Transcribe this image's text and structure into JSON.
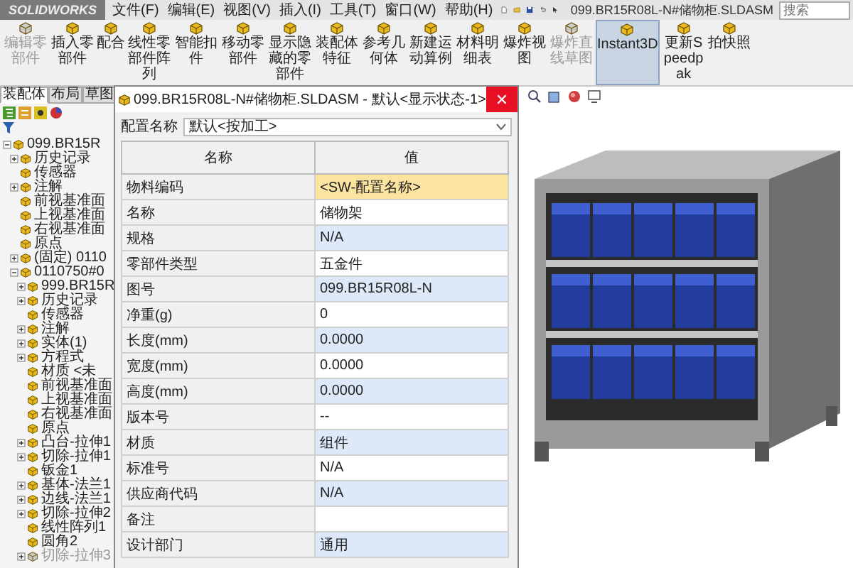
{
  "app": {
    "logo": "SOLIDWORKS",
    "menus": [
      "文件(F)",
      "编辑(E)",
      "视图(V)",
      "插入(I)",
      "工具(T)",
      "窗口(W)",
      "帮助(H)"
    ],
    "document_title": "099.BR15R08L-N#储物柜.SLDASM",
    "search": {
      "placeholder": "搜索"
    }
  },
  "ribbon": [
    {
      "label": "编辑零部件",
      "disabled": true,
      "selected": false
    },
    {
      "label": "插入零部件",
      "disabled": false,
      "selected": false
    },
    {
      "label": "配合",
      "disabled": false,
      "selected": false
    },
    {
      "label": "线性零部件阵列",
      "disabled": false,
      "selected": false
    },
    {
      "label": "智能扣件",
      "disabled": false,
      "selected": false
    },
    {
      "label": "移动零部件",
      "disabled": false,
      "selected": false
    },
    {
      "label": "显示隐藏的零部件",
      "disabled": false,
      "selected": false
    },
    {
      "label": "装配体特征",
      "disabled": false,
      "selected": false
    },
    {
      "label": "参考几何体",
      "disabled": false,
      "selected": false
    },
    {
      "label": "新建运动算例",
      "disabled": false,
      "selected": false
    },
    {
      "label": "材料明细表",
      "disabled": false,
      "selected": false
    },
    {
      "label": "爆炸视图",
      "disabled": false,
      "selected": false
    },
    {
      "label": "爆炸直线草图",
      "disabled": true,
      "selected": false
    },
    {
      "label": "Instant3D",
      "disabled": false,
      "selected": true
    },
    {
      "label": "更新Speedpak",
      "disabled": false,
      "selected": false
    },
    {
      "label": "拍快照",
      "disabled": false,
      "selected": false
    }
  ],
  "panel_tabs": [
    {
      "label": "装配体",
      "selected": true
    },
    {
      "label": "布局",
      "selected": false
    },
    {
      "label": "草图",
      "selected": false
    }
  ],
  "tree": [
    {
      "label": "099.BR15R",
      "expanded": true,
      "suppressed": false,
      "children": [
        {
          "label": "历史记录",
          "expanded": false,
          "suppressed": false
        },
        {
          "label": "传感器",
          "suppressed": false
        },
        {
          "label": "注解",
          "expanded": false,
          "suppressed": false
        },
        {
          "label": "前视基准面",
          "suppressed": false
        },
        {
          "label": "上视基准面",
          "suppressed": false
        },
        {
          "label": "右视基准面",
          "suppressed": false
        },
        {
          "label": "原点",
          "suppressed": false
        },
        {
          "label": "(固定) 0110",
          "expanded": false,
          "suppressed": false
        },
        {
          "label": "0110750#0",
          "expanded": true,
          "suppressed": false,
          "children": [
            {
              "label": "999.BR15R",
              "expanded": false,
              "suppressed": false
            },
            {
              "label": "历史记录",
              "expanded": false,
              "suppressed": false
            },
            {
              "label": "传感器",
              "suppressed": false
            },
            {
              "label": "注解",
              "expanded": false,
              "suppressed": false
            },
            {
              "label": "实体(1)",
              "expanded": false,
              "suppressed": false
            },
            {
              "label": "方程式",
              "expanded": false,
              "suppressed": false
            },
            {
              "label": "材质 <未",
              "suppressed": false
            },
            {
              "label": "前视基准面",
              "suppressed": false
            },
            {
              "label": "上视基准面",
              "suppressed": false
            },
            {
              "label": "右视基准面",
              "suppressed": false
            },
            {
              "label": "原点",
              "suppressed": false
            },
            {
              "label": "凸台-拉伸1",
              "expanded": false,
              "suppressed": false
            },
            {
              "label": "切除-拉伸1",
              "expanded": false,
              "suppressed": false
            },
            {
              "label": "钣金1",
              "suppressed": false
            },
            {
              "label": "基体-法兰1",
              "expanded": false,
              "suppressed": false
            },
            {
              "label": "边线-法兰1",
              "expanded": false,
              "suppressed": false
            },
            {
              "label": "切除-拉伸2",
              "expanded": false,
              "suppressed": false
            },
            {
              "label": "线性阵列1",
              "suppressed": false
            },
            {
              "label": "圆角2",
              "suppressed": false
            },
            {
              "label": "切除-拉伸3",
              "expanded": false,
              "suppressed": true
            }
          ]
        }
      ]
    }
  ],
  "dialog": {
    "close": "✕",
    "title": "099.BR15R08L-N#储物柜.SLDASM - 默认<显示状态-1>",
    "config_label": "配置名称",
    "config_value": "默认<按加工>",
    "columns": [
      "名称",
      "值"
    ],
    "rows": [
      {
        "name": "物料编码",
        "value": "<SW-配置名称>",
        "selected": true
      },
      {
        "name": "名称",
        "value": "储物架",
        "selected": false
      },
      {
        "name": "规格",
        "value": "N/A",
        "selected": false
      },
      {
        "name": "零部件类型",
        "value": "五金件",
        "selected": false
      },
      {
        "name": "图号",
        "value": "099.BR15R08L-N",
        "selected": false
      },
      {
        "name": "净重(g)",
        "value": "0",
        "selected": false
      },
      {
        "name": "长度(mm)",
        "value": "0.0000",
        "selected": false
      },
      {
        "name": "宽度(mm)",
        "value": "0.0000",
        "selected": false
      },
      {
        "name": "高度(mm)",
        "value": "0.0000",
        "selected": false
      },
      {
        "name": "版本号",
        "value": "--",
        "selected": false
      },
      {
        "name": "材质",
        "value": "组件",
        "selected": false
      },
      {
        "name": "标准号",
        "value": "N/A",
        "selected": false
      },
      {
        "name": "供应商代码",
        "value": "N/A",
        "selected": false
      },
      {
        "name": "备注",
        "selected": false
      },
      {
        "name": "设计部门",
        "value": "通用",
        "selected": false
      }
    ]
  }
}
